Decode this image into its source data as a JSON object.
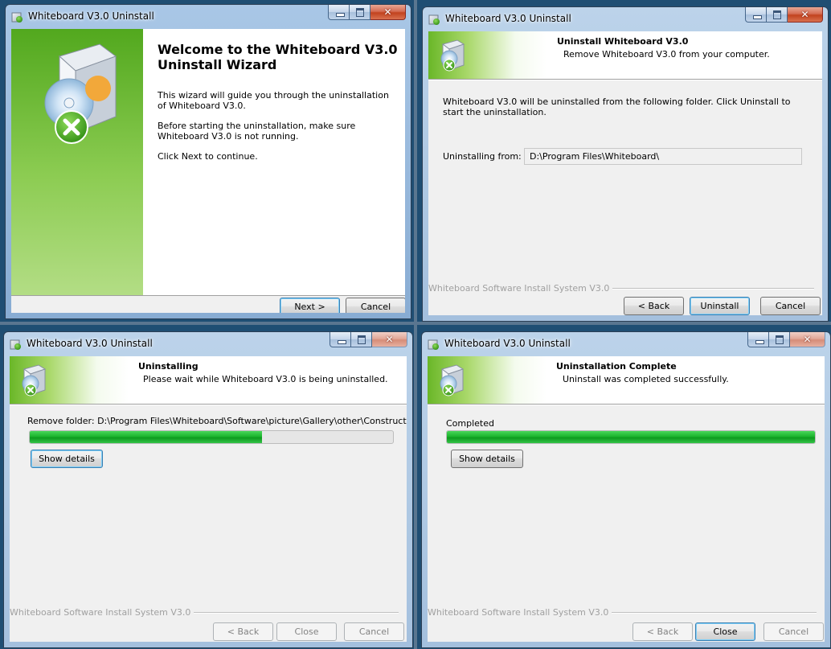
{
  "windows": {
    "welcome": {
      "title": "Whiteboard V3.0 Uninstall",
      "heading": "Welcome to the Whiteboard V3.0 Uninstall Wizard",
      "para1": "This wizard will guide you through the uninstallation of Whiteboard V3.0.",
      "para2": "Before starting the uninstallation, make sure Whiteboard V3.0 is not running.",
      "para3": "Click Next to continue.",
      "next_label": "Next >",
      "cancel_label": "Cancel"
    },
    "confirm": {
      "title": "Whiteboard V3.0 Uninstall",
      "header_title": "Uninstall Whiteboard V3.0",
      "header_subtitle": "Remove Whiteboard V3.0 from your computer.",
      "body": "Whiteboard V3.0 will be uninstalled from the following folder. Click Uninstall to start the uninstallation.",
      "from_label": "Uninstalling from:",
      "from_value": "D:\\Program Files\\Whiteboard\\",
      "brand": "Whiteboard Software Install System V3.0",
      "back_label": "< Back",
      "uninstall_label": "Uninstall",
      "cancel_label": "Cancel"
    },
    "progress": {
      "title": "Whiteboard V3.0 Uninstall",
      "header_title": "Uninstalling",
      "header_subtitle": "Please wait while Whiteboard V3.0 is being uninstalled.",
      "status": "Remove folder: D:\\Program Files\\Whiteboard\\Software\\picture\\Gallery\\other\\Construction\\",
      "progress_fraction": 0.64,
      "show_details_label": "Show details",
      "brand": "Whiteboard Software Install System V3.0",
      "back_label": "< Back",
      "close_label": "Close",
      "cancel_label": "Cancel"
    },
    "complete": {
      "title": "Whiteboard V3.0 Uninstall",
      "header_title": "Uninstallation Complete",
      "header_subtitle": "Uninstall was completed successfully.",
      "status": "Completed",
      "progress_fraction": 1.0,
      "show_details_label": "Show details",
      "brand": "Whiteboard Software Install System V3.0",
      "back_label": "< Back",
      "close_label": "Close",
      "cancel_label": "Cancel"
    }
  },
  "icons": {
    "app": "uninstaller-box-icon",
    "header": "uninstall-package-icon",
    "minimize": "minimize-icon",
    "maximize": "maximize-icon",
    "close": "close-icon"
  },
  "colors": {
    "accent_green": "#6ab728",
    "progress_green": "#1cb52e",
    "titlebar_blue": "#a9c7e6",
    "default_button_border": "#3c7fb1"
  }
}
